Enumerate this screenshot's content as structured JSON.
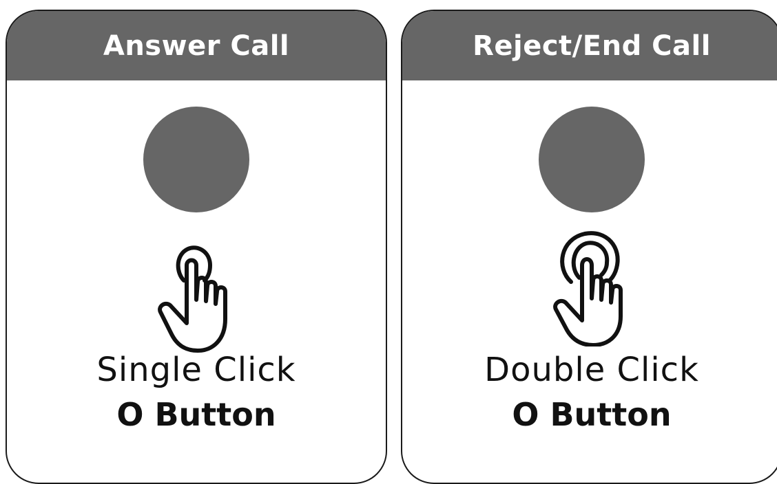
{
  "colors": {
    "header_bg": "#666666",
    "header_text": "#ffffff",
    "button_circle": "#666666",
    "border": "#1a1a1a",
    "text": "#111111"
  },
  "cards": [
    {
      "title": "Answer Call",
      "action": "Single Click",
      "button": "O Button",
      "icon": "single-tap-hand-icon"
    },
    {
      "title": "Reject/End Call",
      "action": "Double Click",
      "button": "O Button",
      "icon": "double-tap-hand-icon"
    }
  ]
}
